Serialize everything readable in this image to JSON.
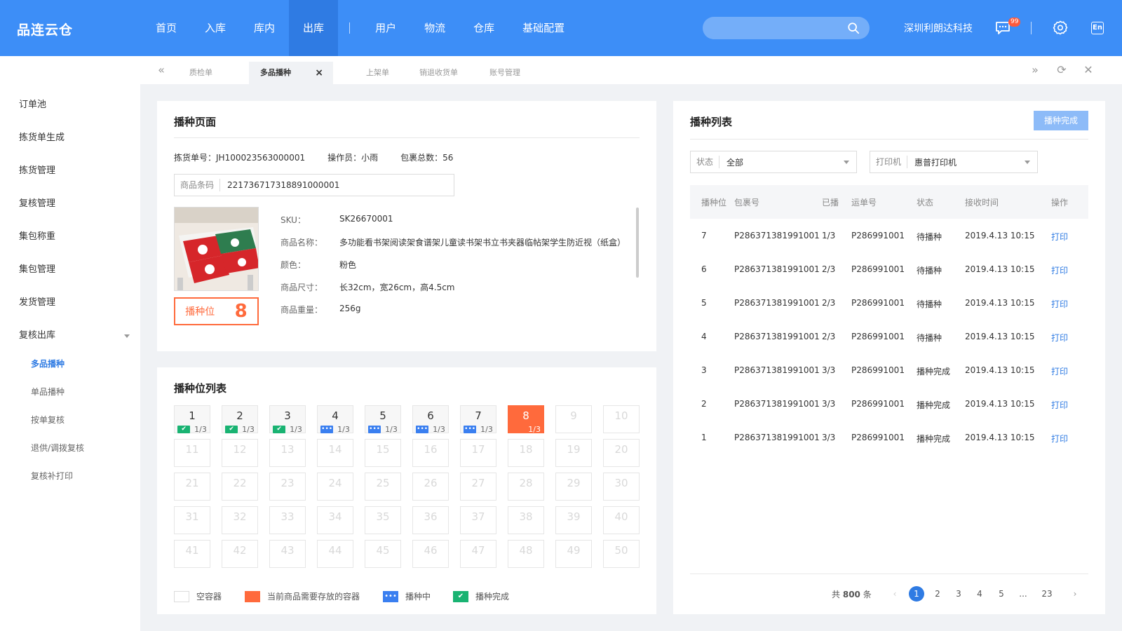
{
  "app": {
    "logo": "品连云仓"
  },
  "nav": {
    "items": [
      "首页",
      "入库",
      "库内",
      "出库",
      "用户",
      "物流",
      "仓库",
      "基础配置"
    ],
    "active_index": 3
  },
  "header": {
    "company": "深圳利朗达科技",
    "badge": "99",
    "lang": "En",
    "search_placeholder": ""
  },
  "sidebar": {
    "items": [
      "订单池",
      "拣货单生成",
      "拣货管理",
      "复核管理",
      "集包称重",
      "集包管理",
      "发货管理",
      "复核出库"
    ],
    "sub_items": [
      "多品播种",
      "单品播种",
      "按单复核",
      "退供/调拨复核",
      "复核补打印"
    ],
    "active_sub": 0
  },
  "tabs": {
    "items": [
      "质检单",
      "多品播种",
      "上架单",
      "销退收货单",
      "账号管理"
    ],
    "active_index": 1,
    "close": "×"
  },
  "sow_page": {
    "title": "播种页面",
    "pick_no_label": "拣货单号：",
    "pick_no": "JH100023563000001",
    "operator_label": "操作员：",
    "operator": "小雨",
    "total_label": "包裹总数：",
    "total": "56",
    "barcode_label": "商品条码",
    "barcode": "221736717318891000001",
    "slot_label": "播种位",
    "slot_no": "8",
    "attrs": [
      {
        "k": "SKU：",
        "v": "SK26670001"
      },
      {
        "k": "商品名称：",
        "v": "多功能看书架阅读架食谱架儿童读书架书立书夹器临帖架学生防近视（纸盒）"
      },
      {
        "k": "颜色：",
        "v": "粉色"
      },
      {
        "k": "商品尺寸：",
        "v": "长32cm，宽26cm，高4.5cm"
      },
      {
        "k": "商品重量：",
        "v": "256g"
      }
    ]
  },
  "slot_list": {
    "title": "播种位列表",
    "filled": [
      {
        "n": "1",
        "status": "done",
        "p": "1/3"
      },
      {
        "n": "2",
        "status": "done",
        "p": "1/3"
      },
      {
        "n": "3",
        "status": "done",
        "p": "1/3"
      },
      {
        "n": "4",
        "status": "doing",
        "p": "1/3"
      },
      {
        "n": "5",
        "status": "doing",
        "p": "1/3"
      },
      {
        "n": "6",
        "status": "doing",
        "p": "1/3"
      },
      {
        "n": "7",
        "status": "doing",
        "p": "1/3"
      },
      {
        "n": "8",
        "status": "current",
        "p": "1/3"
      }
    ],
    "total_slots": 50,
    "legend": [
      "空容器",
      "当前商品需要存放的容器",
      "播种中",
      "播种完成"
    ]
  },
  "sow_list": {
    "title": "播种列表",
    "done_button": "播种完成",
    "status_filter": {
      "label": "状态",
      "value": "全部"
    },
    "printer_filter": {
      "label": "打印机",
      "value": "惠普打印机"
    },
    "columns": [
      "播种位",
      "包裹号",
      "已播",
      "运单号",
      "状态",
      "接收时间",
      "操作"
    ],
    "rows": [
      [
        "7",
        "P286371381991001",
        "1/3",
        "P286991001",
        "待播种",
        "2019.4.13 10:15",
        "打印"
      ],
      [
        "6",
        "P286371381991001",
        "2/3",
        "P286991001",
        "待播种",
        "2019.4.13 10:15",
        "打印"
      ],
      [
        "5",
        "P286371381991001",
        "2/3",
        "P286991001",
        "待播种",
        "2019.4.13 10:15",
        "打印"
      ],
      [
        "4",
        "P286371381991001",
        "2/3",
        "P286991001",
        "待播种",
        "2019.4.13 10:15",
        "打印"
      ],
      [
        "3",
        "P286371381991001",
        "3/3",
        "P286991001",
        "播种完成",
        "2019.4.13 10:15",
        "打印"
      ],
      [
        "2",
        "P286371381991001",
        "3/3",
        "P286991001",
        "播种完成",
        "2019.4.13 10:15",
        "打印"
      ],
      [
        "1",
        "P286371381991001",
        "3/3",
        "P286991001",
        "播种完成",
        "2019.4.13 10:15",
        "打印"
      ]
    ],
    "pager": {
      "total_prefix": "共",
      "total": "800",
      "total_suffix": "条",
      "pages": [
        "1",
        "2",
        "3",
        "4",
        "5",
        "...",
        "23"
      ],
      "active": "1"
    }
  },
  "colors": {
    "primary": "#3d8ef7",
    "accent": "#ff6a3c",
    "done": "#19b372",
    "doing": "#3a7ff0"
  }
}
